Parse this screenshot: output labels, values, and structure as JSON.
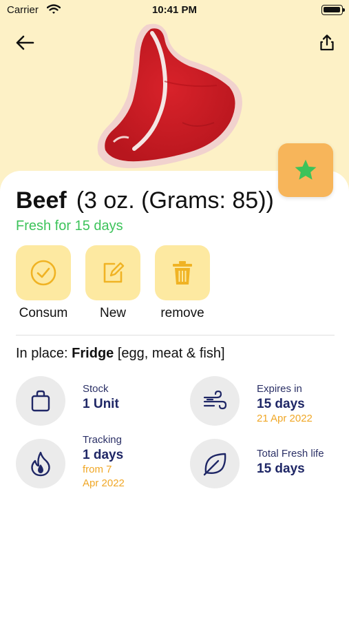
{
  "status_bar": {
    "carrier": "Carrier",
    "time": "10:41 PM"
  },
  "product": {
    "name": "Beef",
    "portion": "(3 oz.  (Grams: 85))",
    "fresh_for": "Fresh for 15 days"
  },
  "actions": [
    {
      "label": "Consum",
      "icon": "check-circle-icon"
    },
    {
      "label": "New",
      "icon": "edit-icon"
    },
    {
      "label": "remove",
      "icon": "trash-icon"
    }
  ],
  "place": {
    "prefix": "In place:",
    "name": "Fridge",
    "detail": "[egg, meat & fish]"
  },
  "stats": {
    "stock": {
      "label": "Stock",
      "value": "1 Unit",
      "icon": "bag-icon"
    },
    "expires": {
      "label": "Expires in",
      "value": "15 days",
      "date": "21 Apr 2022",
      "icon": "wind-icon"
    },
    "tracking": {
      "label": "Tracking",
      "value": "1 days",
      "since_line1": "from 7",
      "since_line2": "Apr 2022",
      "icon": "flame-icon"
    },
    "fresh_life": {
      "label": "Total Fresh life",
      "value": "15 days",
      "icon": "leaf-icon"
    }
  },
  "colors": {
    "hero_bg": "#fdf1c6",
    "accent_green": "#3cc35a",
    "action_tile": "#fde9a1",
    "favorite_bg": "#f7b55a",
    "stat_value": "#1f2766",
    "stat_sub": "#f0a726"
  }
}
